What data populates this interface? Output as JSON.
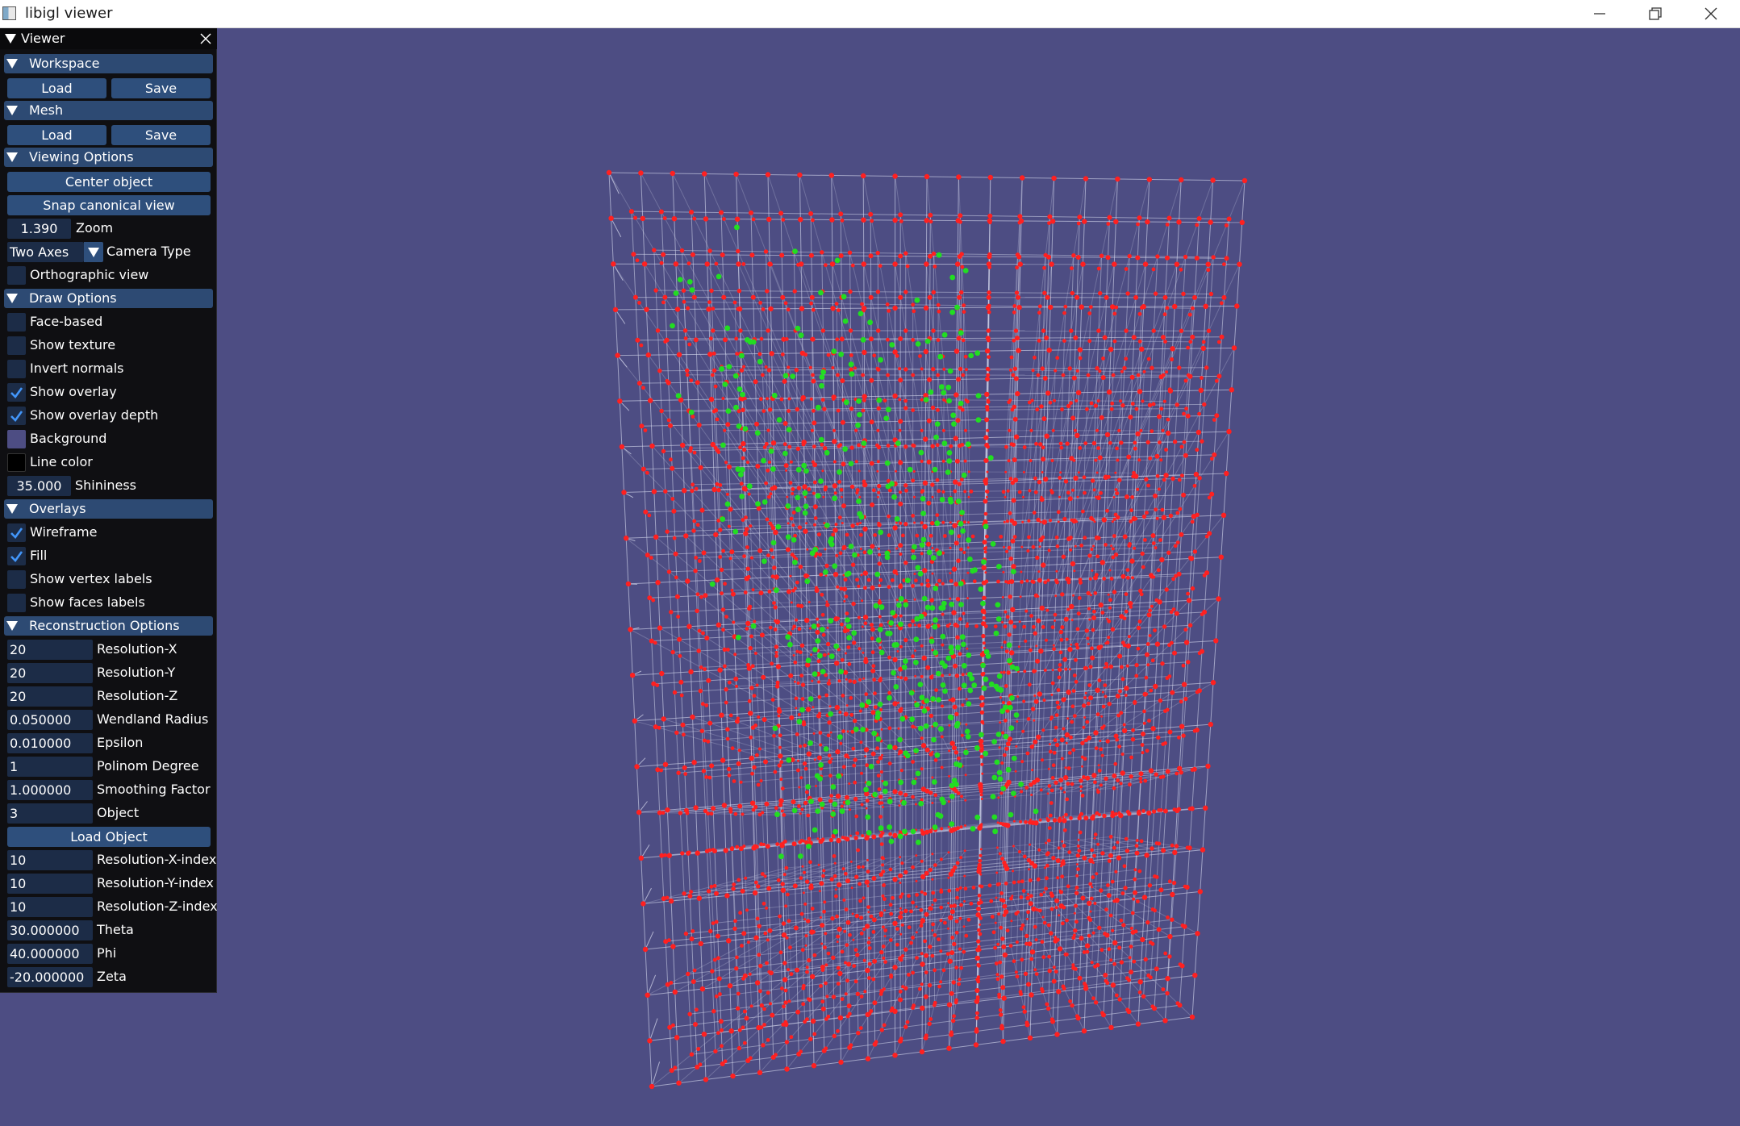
{
  "window": {
    "title": "libigl viewer"
  },
  "panel": {
    "title": "Viewer",
    "workspace": {
      "header": "Workspace",
      "load": "Load",
      "save": "Save"
    },
    "mesh": {
      "header": "Mesh",
      "load": "Load",
      "save": "Save"
    },
    "viewing": {
      "header": "Viewing Options",
      "center_object": "Center object",
      "snap_canonical": "Snap canonical view",
      "zoom_value": "1.390",
      "zoom_label": "Zoom",
      "camera_type_value": "Two Axes",
      "camera_type_label": "Camera Type",
      "orthographic_label": "Orthographic view",
      "orthographic_checked": false
    },
    "draw": {
      "header": "Draw Options",
      "face_based": "Face-based",
      "show_texture": "Show texture",
      "invert_normals": "Invert normals",
      "show_overlay": "Show overlay",
      "show_overlay_depth": "Show overlay depth",
      "background": "Background",
      "background_color": "#4d4d83",
      "line_color": "Line color",
      "line_color_value": "#000000",
      "shininess_value": "35.000",
      "shininess_label": "Shininess",
      "checked": {
        "face_based": false,
        "show_texture": false,
        "invert_normals": false,
        "show_overlay": true,
        "show_overlay_depth": true
      }
    },
    "overlays": {
      "header": "Overlays",
      "wireframe": "Wireframe",
      "fill": "Fill",
      "show_vertex_labels": "Show vertex labels",
      "show_faces_labels": "Show faces labels",
      "checked": {
        "wireframe": true,
        "fill": true,
        "show_vertex_labels": false,
        "show_faces_labels": false
      }
    },
    "reconstruction": {
      "header": "Reconstruction Options",
      "resolution_x": {
        "value": "20",
        "label": "Resolution-X"
      },
      "resolution_y": {
        "value": "20",
        "label": "Resolution-Y"
      },
      "resolution_z": {
        "value": "20",
        "label": "Resolution-Z"
      },
      "wendland_radius": {
        "value": "0.050000",
        "label": "Wendland Radius"
      },
      "epsilon": {
        "value": "0.010000",
        "label": "Epsilon"
      },
      "polinom_degree": {
        "value": "1",
        "label": "Polinom Degree"
      },
      "smoothing_factor": {
        "value": "1.000000",
        "label": "Smoothing Factor"
      },
      "object": {
        "value": "3",
        "label": "Object"
      },
      "load_object": "Load Object",
      "resolution_x_index": {
        "value": "10",
        "label": "Resolution-X-index"
      },
      "resolution_y_index": {
        "value": "10",
        "label": "Resolution-Y-index"
      },
      "resolution_z_index": {
        "value": "10",
        "label": "Resolution-Z-index"
      },
      "theta": {
        "value": "30.000000",
        "label": "Theta"
      },
      "phi": {
        "value": "40.000000",
        "label": "Phi"
      },
      "zeta": {
        "value": "-20.000000",
        "label": "Zeta"
      }
    }
  },
  "colors": {
    "viewport_bg": "#4d4d83",
    "grid_points": "#ff2020",
    "inside_points": "#22dd22",
    "grid_lines": "#d8dcf0"
  }
}
